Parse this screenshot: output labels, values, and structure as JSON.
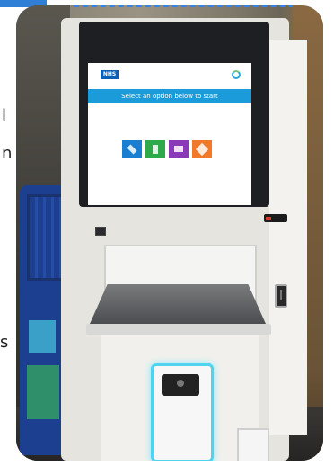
{
  "side_text": [
    "l",
    "n",
    "s"
  ],
  "kiosk": {
    "screen": {
      "logo": "NHS",
      "org": "",
      "banner": "Select an option below to start",
      "options": [
        {
          "label": "",
          "color": "#1a7fd0"
        },
        {
          "label": "",
          "color": "#2eaa4a"
        },
        {
          "label": "",
          "color": "#8a3ab8"
        },
        {
          "label": "",
          "color": "#f07a2a"
        }
      ]
    },
    "accent_colors": {
      "scanner_glow": "#4fd3ef",
      "frame": "#3a82e0"
    }
  }
}
